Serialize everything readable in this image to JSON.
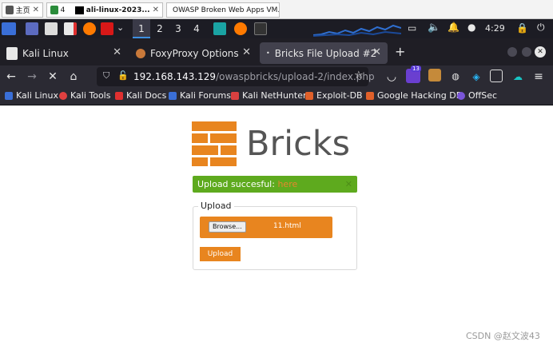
{
  "vm_tabs": [
    {
      "label": "主页"
    },
    {
      "label": "4"
    },
    {
      "label": "ali-linux-2023..."
    },
    {
      "label": "OWASP Broken Web Apps VM..."
    }
  ],
  "panel": {
    "workspaces": [
      "1",
      "2",
      "3",
      "4"
    ],
    "clock": "4:29"
  },
  "browser": {
    "tabs": [
      {
        "label": "Kali Linux"
      },
      {
        "label": "FoxyProxy Options"
      },
      {
        "label": "Bricks File Upload #2"
      }
    ],
    "url_host": "192.168.143.129",
    "url_path": "/owaspbricks/upload-2/index.php",
    "extension_badge": "13",
    "bookmarks": [
      {
        "label": "Kali Linux",
        "icon": "kali-icon"
      },
      {
        "label": "Kali Tools",
        "icon": "kali-tools-icon"
      },
      {
        "label": "Kali Docs",
        "icon": "kali-docs-icon"
      },
      {
        "label": "Kali Forums",
        "icon": "kali-forums-icon"
      },
      {
        "label": "Kali NetHunter",
        "icon": "nethunter-icon"
      },
      {
        "label": "Exploit-DB",
        "icon": "exploit-db-icon"
      },
      {
        "label": "Google Hacking DB",
        "icon": "ghdb-icon"
      },
      {
        "label": "OffSec",
        "icon": "offsec-icon"
      }
    ]
  },
  "page": {
    "brand": "Bricks",
    "alert_text": "Upload succesful: ",
    "alert_link": "here",
    "fieldset_legend": "Upload",
    "browse_label": "Browse...",
    "file_name": "11.html",
    "upload_label": "Upload"
  },
  "watermark": "CSDN @赵文波43",
  "colors": {
    "brand_orange": "#e8851f",
    "success_green": "#5eaa1e",
    "kali_panel": "#1c1c24"
  }
}
